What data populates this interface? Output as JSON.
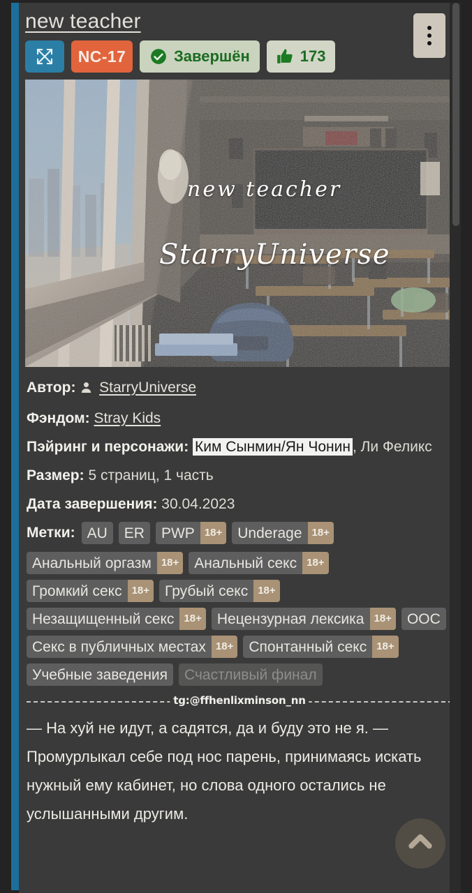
{
  "header": {
    "title": "new teacher",
    "menu_icon": "kebab-menu-icon"
  },
  "badges": {
    "category_icon": "crossed-arrows-icon",
    "rating": "NC-17",
    "status_label": "Завершён",
    "status_icon": "check-circle-icon",
    "likes_count": "173",
    "likes_icon": "thumbs-up-icon"
  },
  "cover": {
    "overlay_title": "new teacher",
    "overlay_author": "StarryUniverse"
  },
  "meta": {
    "author_label": "Автор:",
    "author_name": "StarryUniverse",
    "author_icon": "person-icon",
    "fandom_label": "Фэндом:",
    "fandom_value": "Stray Kids",
    "pairing_label": "Пэйринг и персонажи:",
    "pairing_highlight": "Ким Сынмин/Ян Чонин",
    "pairing_rest": ", Ли Феликс",
    "size_label": "Размер:",
    "size_value": "5 страниц, 1 часть",
    "date_label": "Дата завершения:",
    "date_value": "30.04.2023"
  },
  "tags": {
    "label": "Метки:",
    "items": [
      {
        "text": "AU",
        "adult": ""
      },
      {
        "text": "ER",
        "adult": ""
      },
      {
        "text": "PWP",
        "adult": "18+"
      },
      {
        "text": "Underage",
        "adult": "18+"
      },
      {
        "text": "Анальный оргазм",
        "adult": "18+"
      },
      {
        "text": "Анальный секс",
        "adult": "18+"
      },
      {
        "text": "Громкий секс",
        "adult": "18+"
      },
      {
        "text": "Грубый секс",
        "adult": "18+"
      },
      {
        "text": "Незащищенный секс",
        "adult": "18+"
      },
      {
        "text": "Нецензурная лексика",
        "adult": "18+"
      },
      {
        "text": "ООС",
        "adult": ""
      },
      {
        "text": "Секс в публичных местах",
        "adult": "18+"
      },
      {
        "text": "Спонтанный секс",
        "adult": "18+"
      },
      {
        "text": "Учебные заведения",
        "adult": ""
      },
      {
        "text": "Счастливый финал",
        "adult": "",
        "faded": true
      }
    ]
  },
  "divider": {
    "watermark": "tg:@ffhenlixminson_nn"
  },
  "body": {
    "paragraph": "— На хуй не идут, а садятся, да и буду это не я. — Промурлыкал себе под нос парень, принимаясь искать нужный ему кабинет, но слова одного остались не услышанными другим."
  },
  "fab": {
    "scroll_top_icon": "chevron-up-icon"
  },
  "colors": {
    "accent_stripe": "#1c6f9b",
    "card_bg": "#3a3a3a",
    "page_bg": "#232323",
    "rating_bg": "#e2643c",
    "status_bg": "#c9d3bd",
    "status_text": "#1b6b22",
    "tag_bg": "#5e5e5e",
    "adult_bg": "#a99275",
    "category_bg": "#2b7fa6"
  }
}
